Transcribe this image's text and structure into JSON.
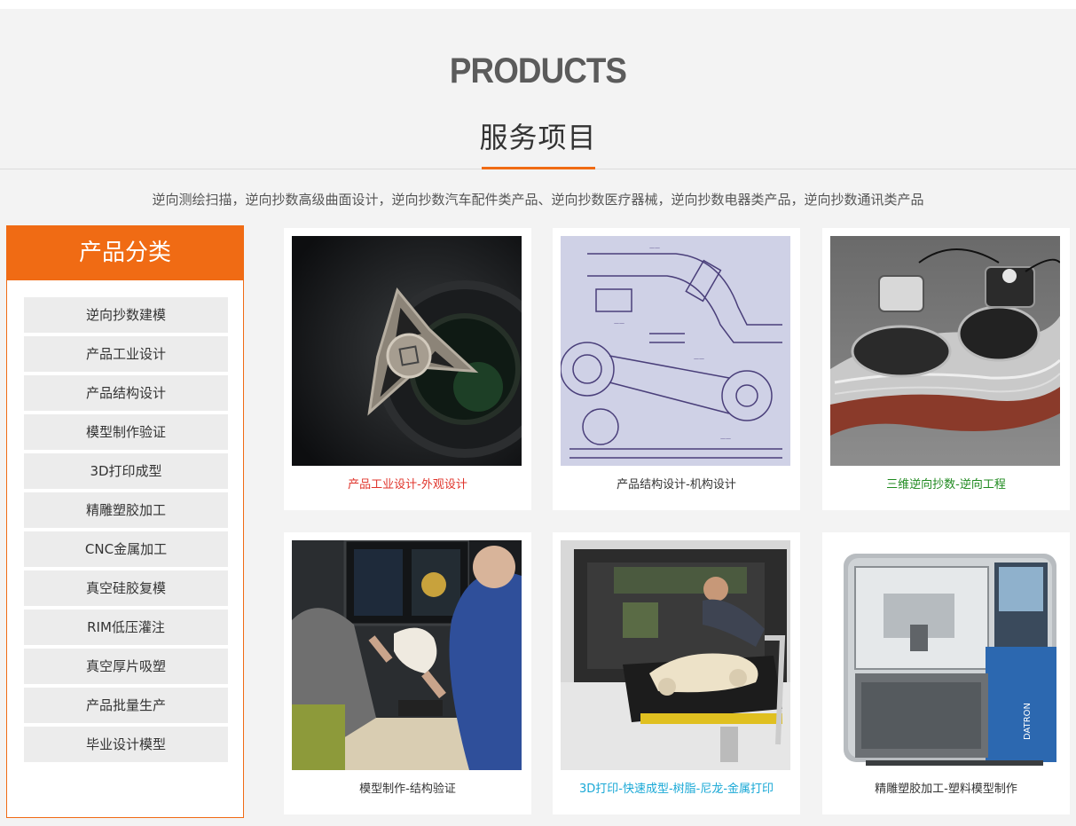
{
  "header": {
    "en_title": "PRODUCTS",
    "cn_title": "服务项目",
    "subtitle": "逆向测绘扫描，逆向抄数高级曲面设计，逆向抄数汽车配件类产品、逆向抄数医疗器械，逆向抄数电器类产品，逆向抄数通讯类产品",
    "accent_color": "#f06b14"
  },
  "sidebar": {
    "title": "产品分类",
    "items": [
      "逆向抄数建模",
      "产品工业设计",
      "产品结构设计",
      "模型制作验证",
      "3D打印成型",
      "精雕塑胶加工",
      "CNC金属加工",
      "真空硅胶复模",
      "RIM低压灌注",
      "真空厚片吸塑",
      "产品批量生产",
      "毕业设计模型"
    ]
  },
  "products": [
    {
      "caption": "产品工业设计-外观设计",
      "caption_color": "#e0342b",
      "image": "fidget-spinner-photo"
    },
    {
      "caption": "产品结构设计-机构设计",
      "caption_color": "#333333",
      "image": "technical-drawing-photo"
    },
    {
      "caption": "三维逆向抄数-逆向工程",
      "caption_color": "#1f8a1f",
      "image": "headlamp-render-photo"
    },
    {
      "caption": "模型制作-结构验证",
      "caption_color": "#333333",
      "image": "model-review-photo"
    },
    {
      "caption": "3D打印-快速成型-树脂-尼龙-金属打印",
      "caption_color": "#19a8d6",
      "image": "3d-printer-photo"
    },
    {
      "caption": "精雕塑胶加工-塑料模型制作",
      "caption_color": "#333333",
      "image": "cnc-machine-photo"
    }
  ]
}
